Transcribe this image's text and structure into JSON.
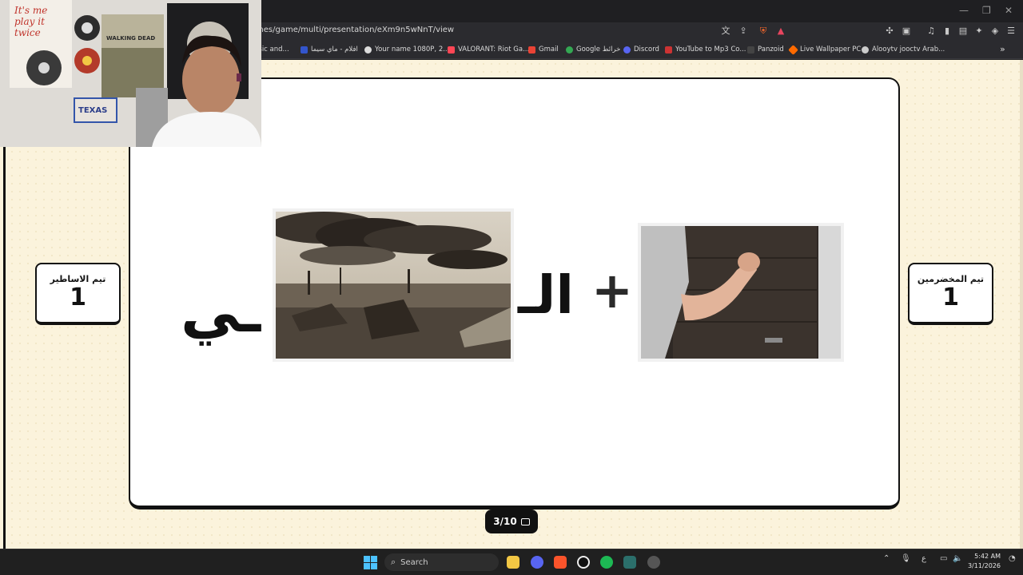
{
  "browser": {
    "url": "mes/game/multi/presentation/eXm9n5wNnT/view",
    "bookmarks": [
      {
        "label": "usic and...",
        "color": "#888888"
      },
      {
        "label": "افلام - ماي سيما",
        "color": "#3355cc"
      },
      {
        "label": "Your name 1080P, 2...",
        "color": "#dddddd"
      },
      {
        "label": "VALORANT: Riot Ga...",
        "color": "#ff4655"
      },
      {
        "label": "Gmail",
        "color": "#ea4335"
      },
      {
        "label": "Google خرائط",
        "color": "#34a853"
      },
      {
        "label": "Discord",
        "color": "#5865f2"
      },
      {
        "label": "YouTube to Mp3 Co...",
        "color": "#cc3333"
      },
      {
        "label": "Panzoid",
        "color": "#444444"
      },
      {
        "label": "Live Wallpaper PC",
        "color": "#ff6a00"
      },
      {
        "label": "Alooytv jooctv Arab...",
        "color": "#cccccc"
      }
    ]
  },
  "game": {
    "team_right": {
      "name": "تيم المخضرمين",
      "score": "1"
    },
    "team_left": {
      "name": "تيم الاساطير",
      "score": "1"
    },
    "puzzle": {
      "plus": "+",
      "al": "الـ",
      "ya": "ـي"
    },
    "counter": "3/10"
  },
  "taskbar": {
    "search_placeholder": "Search",
    "lang": "ع",
    "time": "5:42 AM",
    "date": "3/11/2026"
  },
  "webcam": {
    "poster_text_1": "It's me play it twice",
    "poster_text_2": "WALKING DEAD",
    "plate_text": "TEXAS"
  }
}
